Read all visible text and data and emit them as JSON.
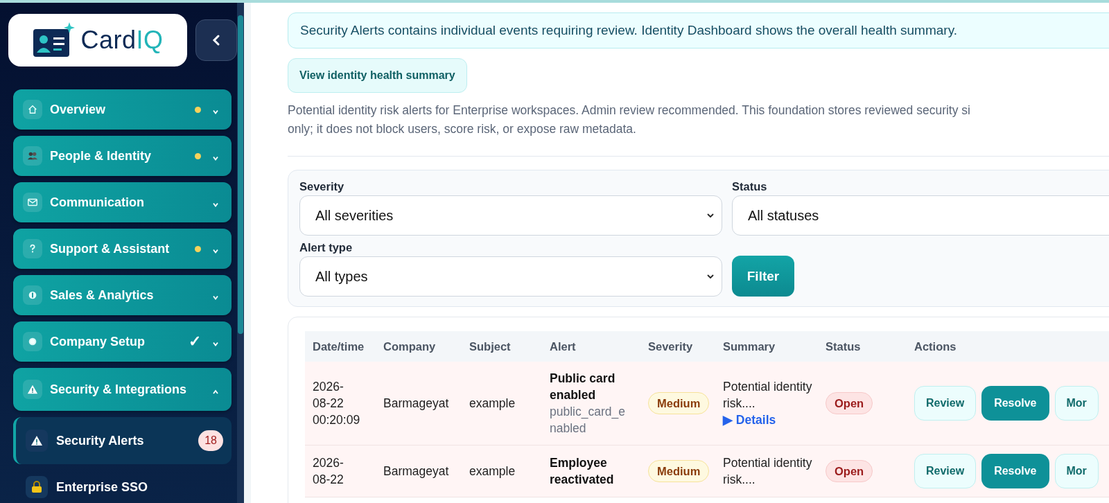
{
  "sidebar": {
    "logo": {
      "text_a": "Card",
      "text_b": "IQ"
    },
    "nav": [
      {
        "label": "Overview",
        "has_update": true,
        "expanded": false
      },
      {
        "label": "People & Identity",
        "has_update": true,
        "expanded": false
      },
      {
        "label": "Communication",
        "has_update": false,
        "expanded": false
      },
      {
        "label": "Support & Assistant",
        "has_update": true,
        "expanded": false
      },
      {
        "label": "Sales & Analytics",
        "has_update": false,
        "expanded": false
      },
      {
        "label": "Company Setup",
        "has_update": false,
        "status_mark": "✓",
        "expanded": false
      },
      {
        "label": "Security & Integrations",
        "has_update": false,
        "expanded": true,
        "children": [
          {
            "label": "Security Alerts",
            "selected": true,
            "badge": "18"
          },
          {
            "label": "Enterprise SSO",
            "selected": false
          }
        ]
      }
    ]
  },
  "main": {
    "banner": "Security Alerts contains individual events requiring review. Identity Dashboard shows the overall health summary.",
    "summary_button": "View identity health summary",
    "description_lines": [
      "Potential identity risk alerts for Enterprise workspaces. Admin review recommended. This foundation stores reviewed security si",
      "only; it does not block users, score risk, or expose raw metadata."
    ],
    "filters": {
      "severity": {
        "label": "Severity",
        "value": "All severities"
      },
      "status": {
        "label": "Status",
        "value": "All statuses"
      },
      "alert_type": {
        "label": "Alert type",
        "value": "All types"
      },
      "button": "Filter"
    },
    "table": {
      "columns": [
        "Date/time",
        "Company",
        "Subject",
        "Alert",
        "Severity",
        "Summary",
        "Status",
        "Actions"
      ],
      "rows": [
        {
          "datetime": "2026-08-22 00:20:09",
          "company": "Barmageyat",
          "subject": "example",
          "alert_title": "Public card enabled",
          "alert_code": "public_card_enabled",
          "severity": "Medium",
          "summary": "Potential identity risk....",
          "details": "▶ Details",
          "status": "Open",
          "actions": [
            {
              "label": "Review",
              "kind": "secondary"
            },
            {
              "label": "Resolve",
              "kind": "primary"
            },
            {
              "label": "Mor",
              "kind": "secondary"
            }
          ]
        },
        {
          "datetime": "2026-08-22",
          "company": "Barmageyat",
          "subject": "example",
          "alert_title": "Employee reactivated",
          "severity": "Medium",
          "summary": "Potential identity risk....",
          "status": "Open",
          "actions": [
            {
              "label": "Review",
              "kind": "secondary"
            },
            {
              "label": "Resolve",
              "kind": "primary"
            },
            {
              "label": "Mor",
              "kind": "secondary"
            }
          ]
        }
      ]
    }
  }
}
